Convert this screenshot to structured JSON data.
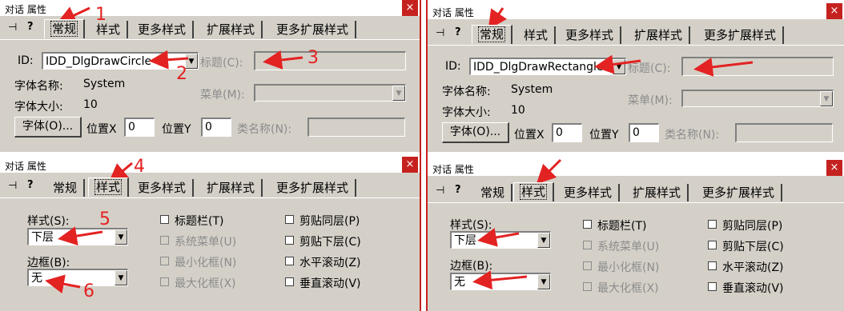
{
  "dialog_title": "对话 属性",
  "close_glyph": "×",
  "tabs": [
    "常规",
    "样式",
    "更多样式",
    "扩展样式",
    "更多扩展样式"
  ],
  "general": {
    "id_label": "ID:",
    "title_label": "标题(C):",
    "font_name_label": "字体名称:",
    "font_name_value": "System",
    "font_size_label": "字体大小:",
    "font_size_value": "10",
    "menu_label": "菜单(M):",
    "font_button": "字体(O)...",
    "pos_x_label": "位置X",
    "pos_x_value": "0",
    "pos_y_label": "位置Y",
    "pos_y_value": "0",
    "class_label": "类名称(N):"
  },
  "top_left": {
    "id_value": "IDD_DlgDrawCircle"
  },
  "top_right": {
    "id_value": "IDD_DlgDrawRectangle"
  },
  "style": {
    "style_label": "样式(S):",
    "style_value": "下层",
    "border_label": "边框(B):",
    "border_value": "无",
    "checks_left": [
      "标题栏(T)",
      "系统菜单(U)",
      "最小化框(N)",
      "最大化框(X)"
    ],
    "checks_right": [
      "剪贴同层(P)",
      "剪贴下层(C)",
      "水平滚动(Z)",
      "垂直滚动(V)"
    ]
  },
  "annotations": [
    "1",
    "2",
    "3",
    "4",
    "5",
    "6"
  ],
  "colors": {
    "dialog_bg": "#d4d0c8",
    "annotation": "#e32222",
    "close": "#c5221f"
  },
  "icons": {
    "pin": "pushpin-icon",
    "help": "help-icon"
  }
}
